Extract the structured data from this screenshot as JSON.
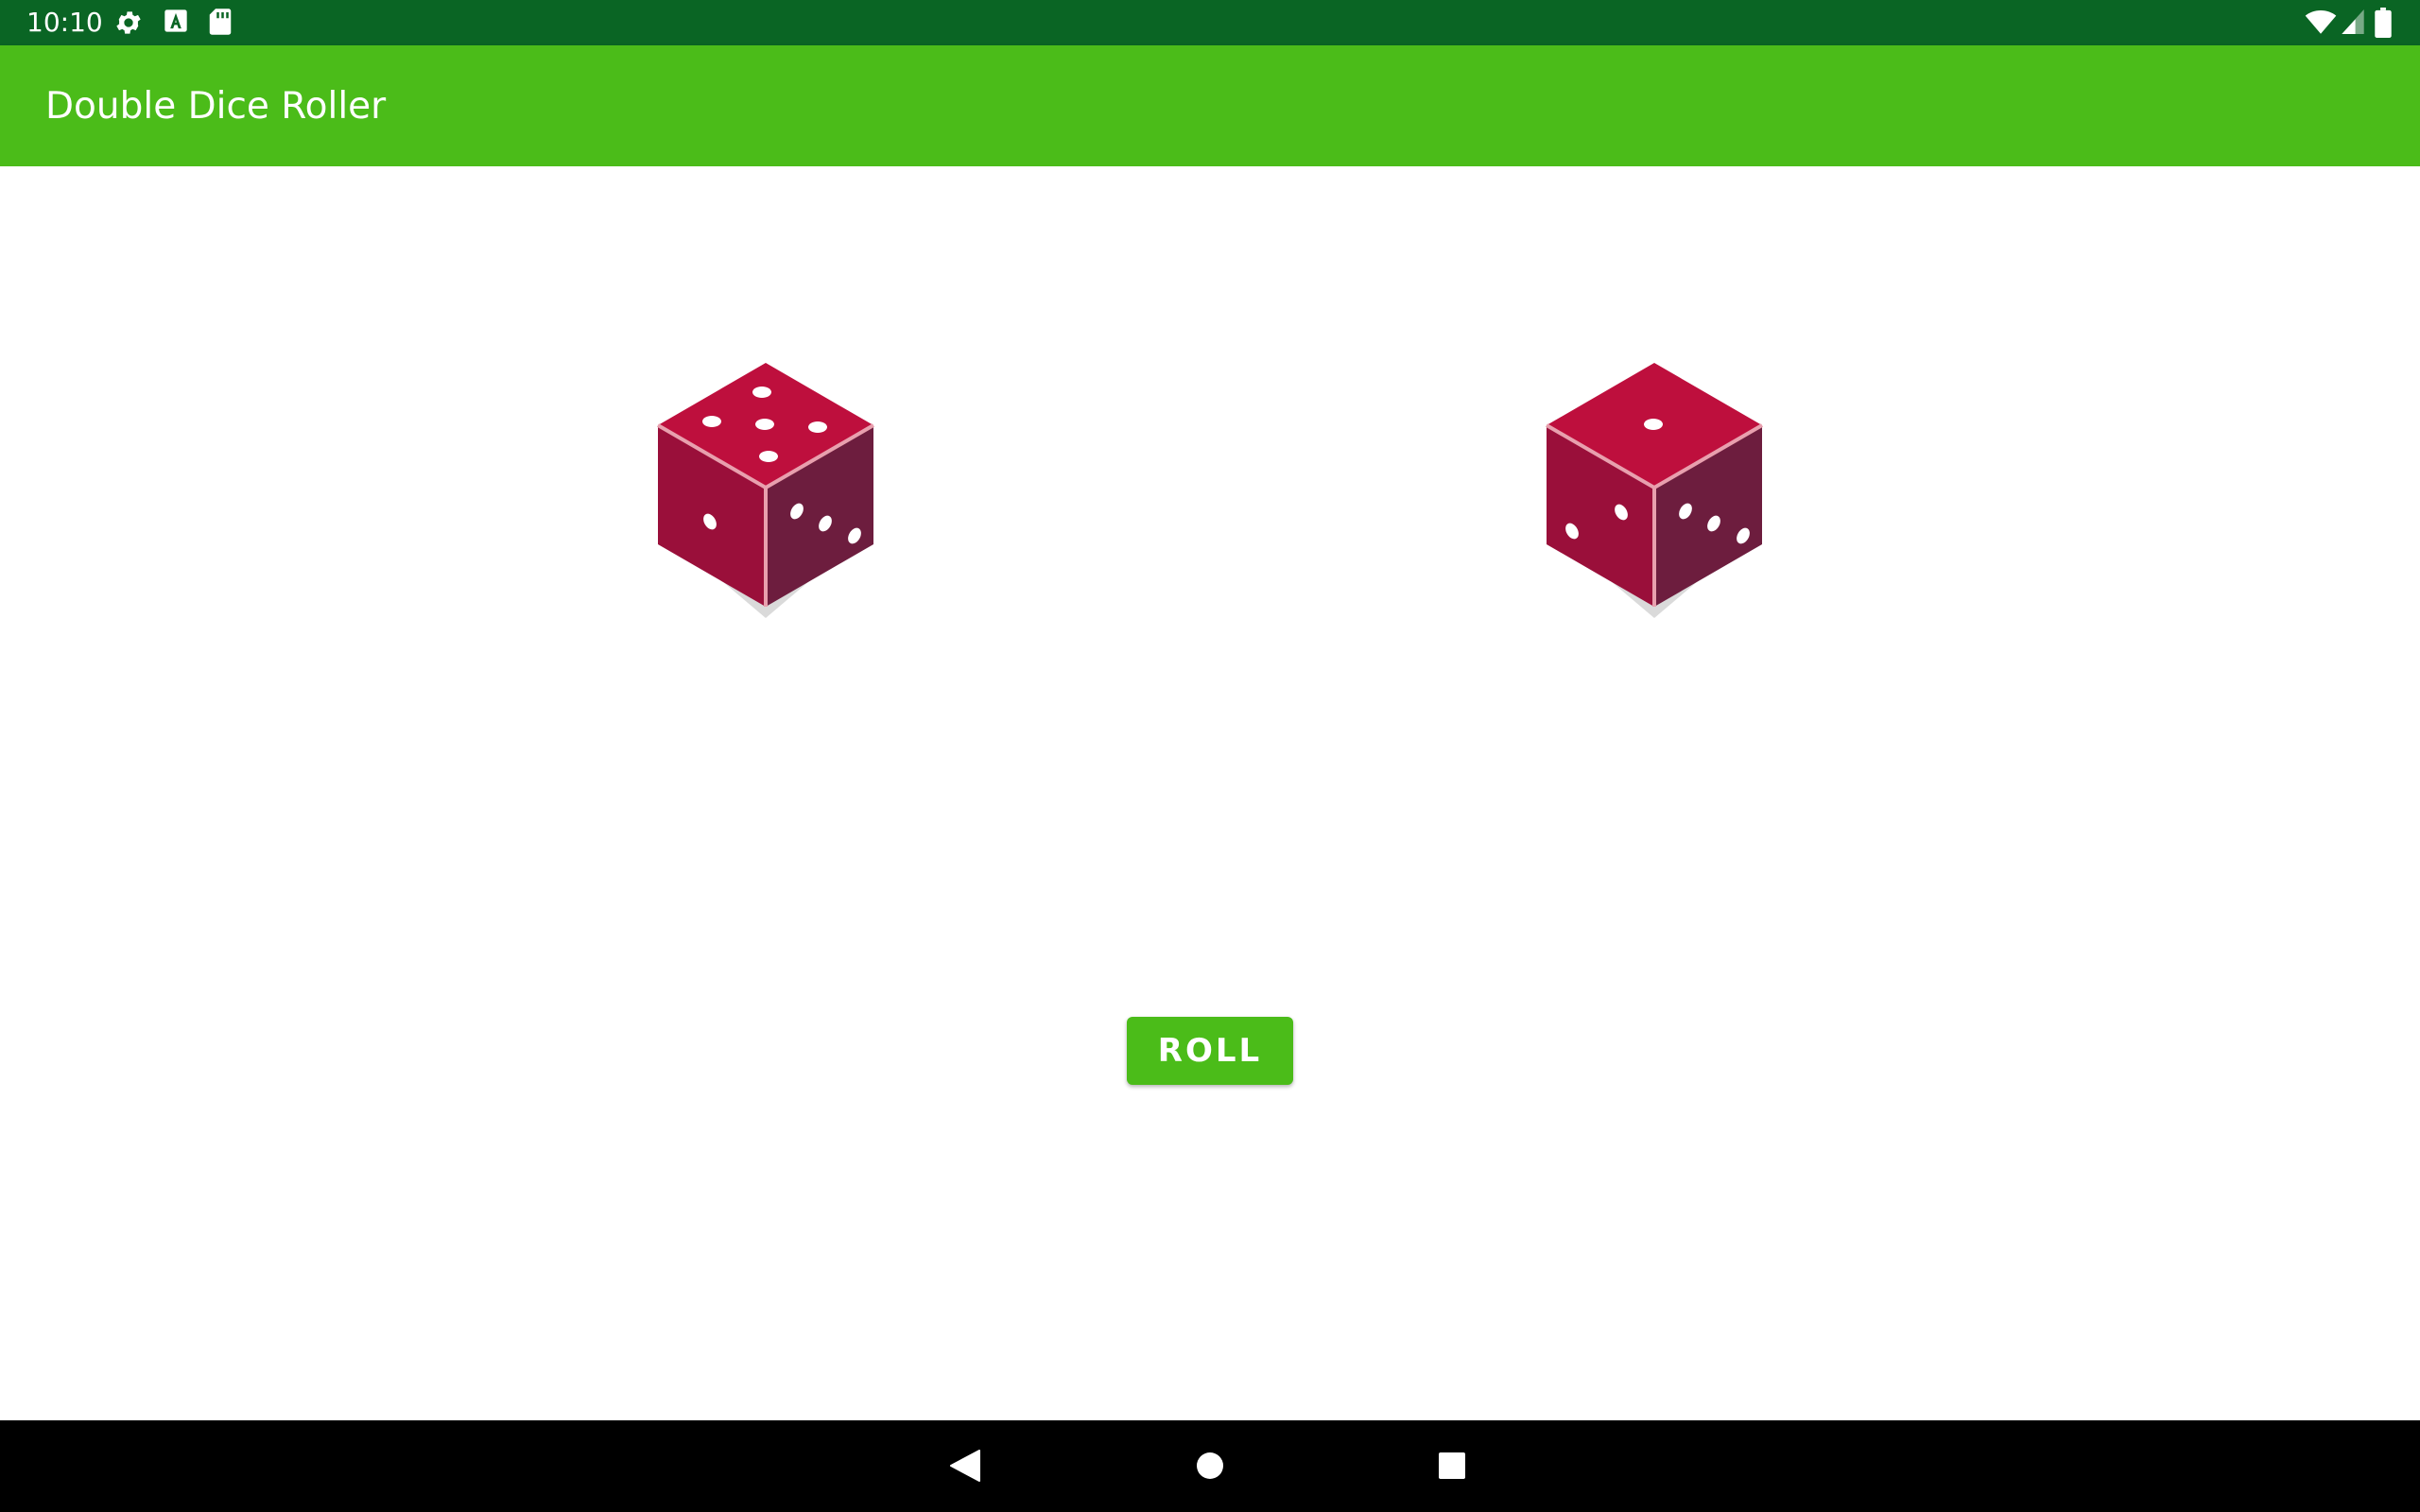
{
  "status_bar": {
    "time": "10:10",
    "left_icons": [
      "gear-icon",
      "font-a-icon",
      "sd-card-icon"
    ],
    "right_icons": [
      "wifi-icon",
      "cell-signal-icon",
      "battery-icon"
    ],
    "background": "#0a6524"
  },
  "app_bar": {
    "title": "Double Dice Roller",
    "background": "#4bbc19"
  },
  "dice": [
    {
      "top_face": 5,
      "left_face": 1,
      "right_face": 3
    },
    {
      "top_face": 1,
      "left_face": 2,
      "right_face": 3
    }
  ],
  "roll_button": {
    "label": "ROLL",
    "background": "#4bbc19"
  },
  "nav_bar": {
    "buttons": [
      "back-icon",
      "home-icon",
      "recents-icon"
    ],
    "background": "#000000"
  },
  "colors": {
    "die_top": "#be0f3d",
    "die_left": "#9a0f3a",
    "die_right": "#6d1d3e",
    "die_edge": "#e8a0ae",
    "die_shadow": "#dadada"
  }
}
